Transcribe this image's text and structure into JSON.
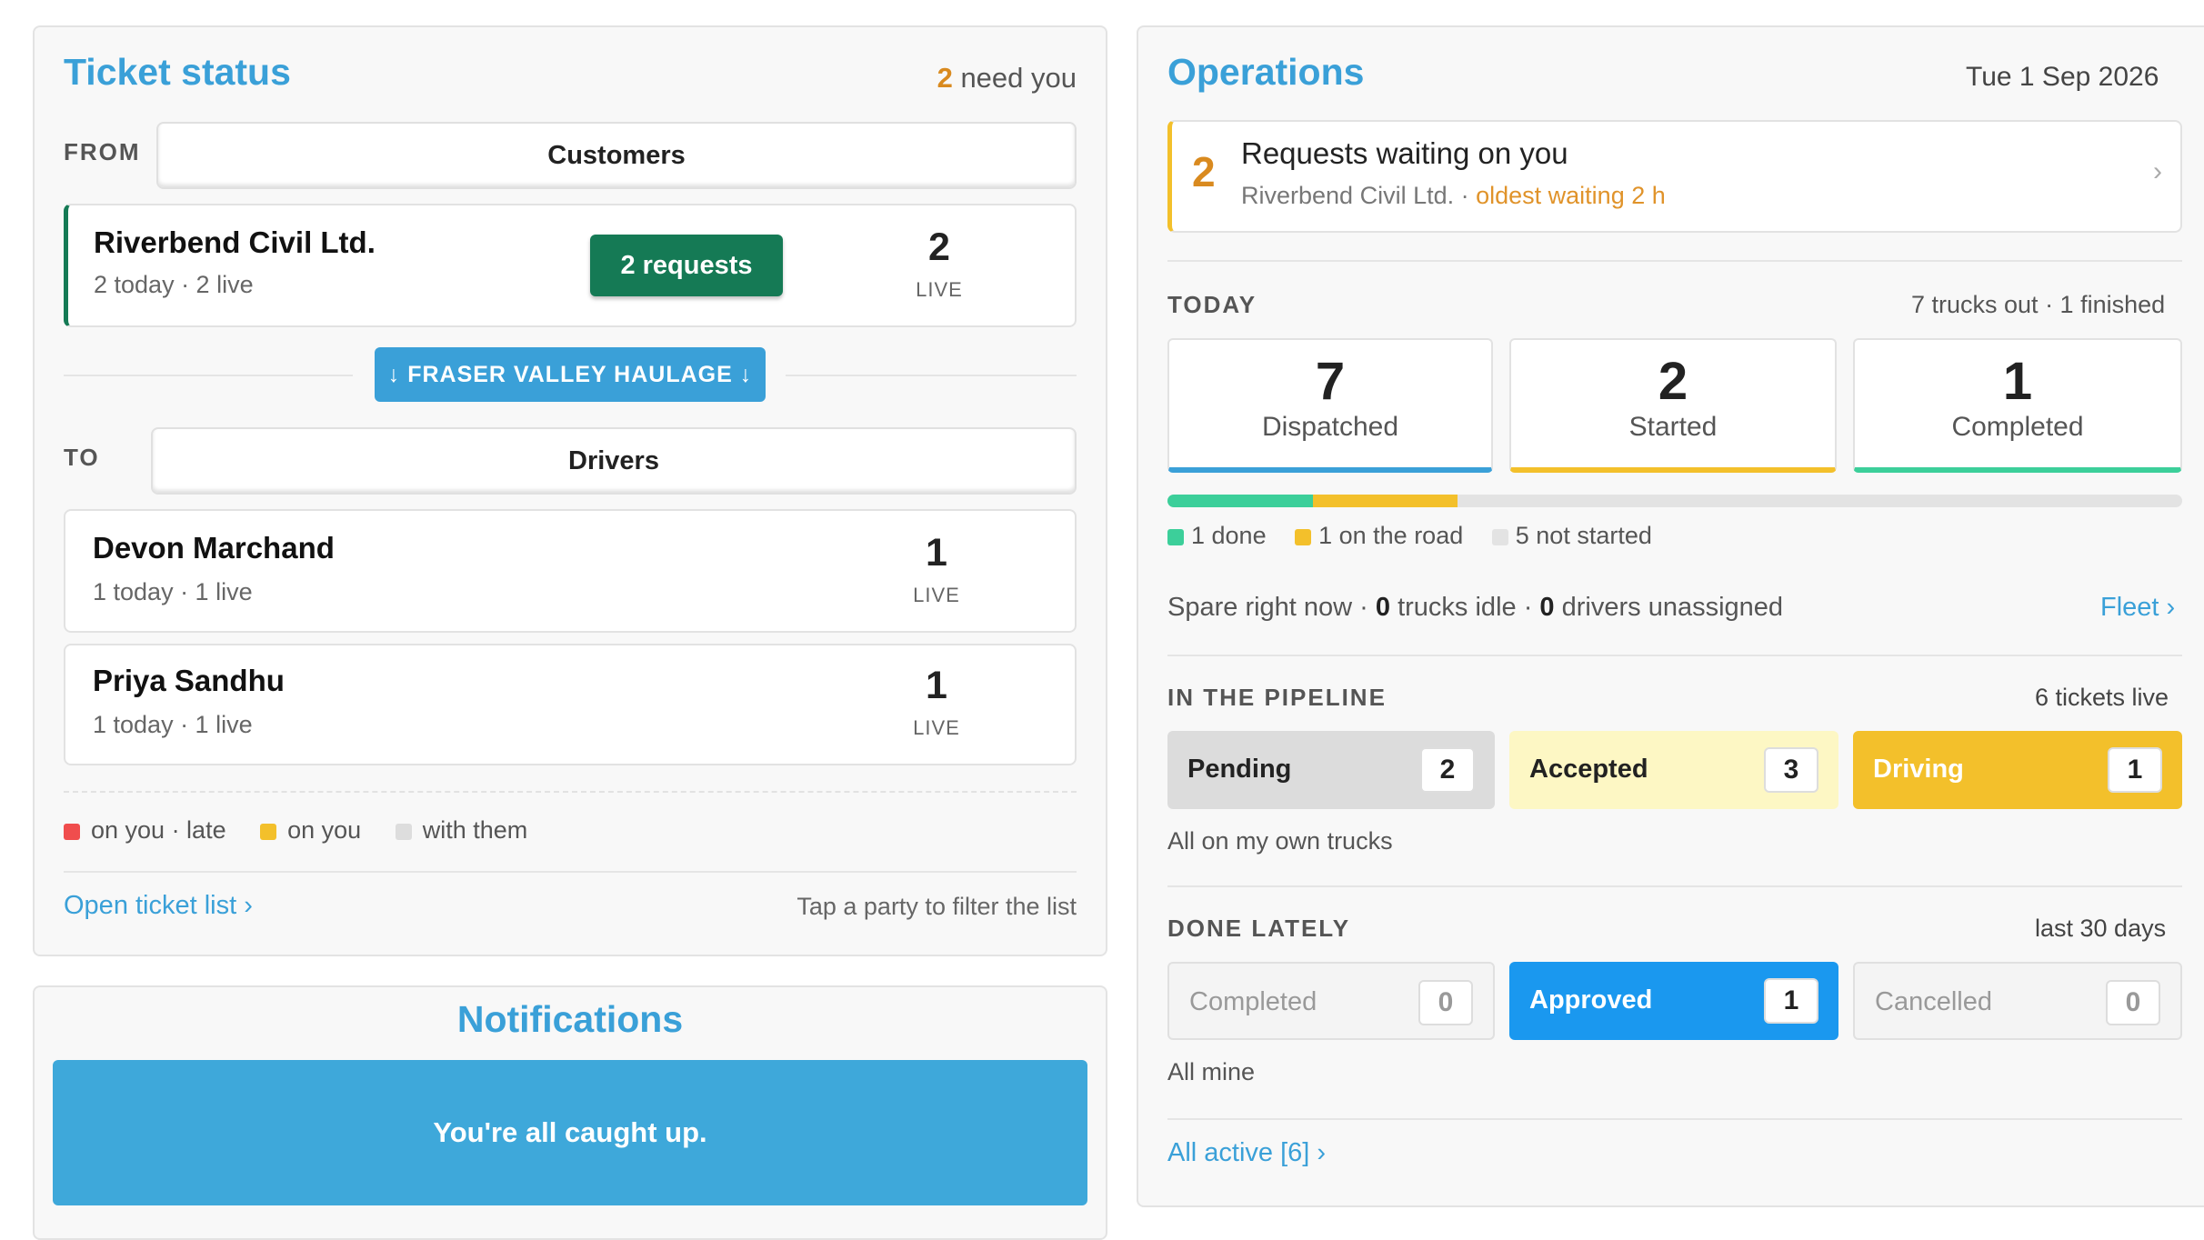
{
  "ticket_status": {
    "title": "Ticket status",
    "need_count": "2",
    "need_suffix": "need you",
    "from_label": "FROM",
    "from_value": "Customers",
    "customer": {
      "name": "Riverbend Civil Ltd.",
      "meta": "2 today · 2 live",
      "requests_button": "2 requests",
      "live_count": "2",
      "live_label": "LIVE"
    },
    "hauler_button": "↓ FRASER VALLEY HAULAGE ↓",
    "to_label": "TO",
    "to_value": "Drivers",
    "drivers": [
      {
        "name": "Devon Marchand",
        "meta": "1 today · 1 live",
        "live_count": "1",
        "live_label": "LIVE"
      },
      {
        "name": "Priya Sandhu",
        "meta": "1 today · 1 live",
        "live_count": "1",
        "live_label": "LIVE"
      }
    ],
    "legend": [
      {
        "label": "on you · late",
        "color": "#f04d4d"
      },
      {
        "label": "on you",
        "color": "#f3c02b"
      },
      {
        "label": "with them",
        "color": "#dddddd"
      }
    ],
    "open_list_link": "Open ticket list ›",
    "hint": "Tap a party to filter the list"
  },
  "notifications": {
    "title": "Notifications",
    "banner": "You're all caught up."
  },
  "operations": {
    "title": "Operations",
    "date": "Tue 1 Sep 2026",
    "waiting": {
      "count": "2",
      "title": "Requests waiting on you",
      "party": "Riverbend Civil Ltd. ·",
      "oldest": "oldest waiting 2 h",
      "chevron": "›"
    },
    "today": {
      "label": "TODAY",
      "summary": "7 trucks out · 1 finished",
      "stats": [
        {
          "value": "7",
          "label": "Dispatched",
          "color": "#3aa0d8"
        },
        {
          "value": "2",
          "label": "Started",
          "color": "#f3c02b"
        },
        {
          "value": "1",
          "label": "Completed",
          "color": "#3ccf9a"
        }
      ],
      "progress": {
        "done_fraction": 0.143,
        "road_fraction": 0.143
      },
      "progress_legend": [
        {
          "label": "1 done",
          "color": "#3ccf9a"
        },
        {
          "label": "1 on the road",
          "color": "#f3c02b"
        },
        {
          "label": "5 not started",
          "color": "#e3e3e3"
        }
      ],
      "spare_prefix": "Spare right now ·",
      "spare_idle_count": "0",
      "spare_idle_label": "trucks idle ·",
      "spare_driver_count": "0",
      "spare_driver_label": "drivers unassigned",
      "fleet_link": "Fleet ›"
    },
    "pipeline": {
      "label": "IN THE PIPELINE",
      "summary": "6 tickets live",
      "items": [
        {
          "label": "Pending",
          "count": "2"
        },
        {
          "label": "Accepted",
          "count": "3"
        },
        {
          "label": "Driving",
          "count": "1"
        }
      ],
      "note": "All on my own trucks"
    },
    "done": {
      "label": "DONE LATELY",
      "summary": "last 30 days",
      "items": [
        {
          "label": "Completed",
          "count": "0"
        },
        {
          "label": "Approved",
          "count": "1"
        },
        {
          "label": "Cancelled",
          "count": "0"
        }
      ],
      "note": "All mine"
    },
    "all_active_link": "All active [6] ›"
  }
}
